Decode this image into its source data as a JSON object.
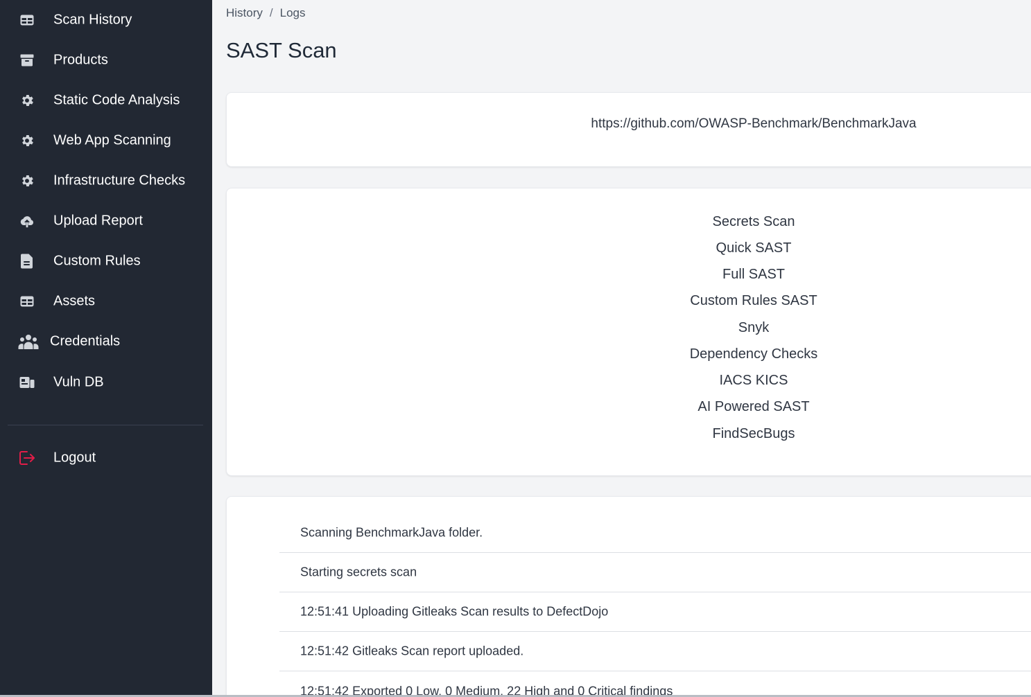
{
  "sidebar": {
    "items": [
      {
        "label": "Scan History",
        "icon": "table-icon"
      },
      {
        "label": "Products",
        "icon": "archive-icon"
      },
      {
        "label": "Static Code Analysis",
        "icon": "gear-icon"
      },
      {
        "label": "Web App Scanning",
        "icon": "gear-icon"
      },
      {
        "label": "Infrastructure Checks",
        "icon": "gear-icon"
      },
      {
        "label": "Upload Report",
        "icon": "cloud-upload-icon"
      },
      {
        "label": "Custom Rules",
        "icon": "document-icon"
      },
      {
        "label": "Assets",
        "icon": "table-icon"
      },
      {
        "label": "Credentials",
        "icon": "people-icon"
      },
      {
        "label": "Vuln DB",
        "icon": "database-icon"
      }
    ],
    "logout": {
      "label": "Logout",
      "icon": "logout-icon",
      "color": "#e11d48"
    }
  },
  "breadcrumb": {
    "items": [
      "History",
      "Logs"
    ],
    "separator": "/"
  },
  "page": {
    "title": "SAST Scan"
  },
  "repo": {
    "url": "https://github.com/OWASP-Benchmark/BenchmarkJava"
  },
  "scan_options": [
    "Secrets Scan",
    "Quick SAST",
    "Full SAST",
    "Custom Rules SAST",
    "Snyk",
    "Dependency Checks",
    "IACS KICS",
    "AI Powered SAST",
    "FindSecBugs"
  ],
  "logs": [
    "Scanning BenchmarkJava folder.",
    "Starting secrets scan",
    "12:51:41 Uploading Gitleaks Scan results to DefectDojo",
    "12:51:42 Gitleaks Scan report uploaded.",
    "12:51:42 Exported 0 Low, 0 Medium, 22 High and 0 Critical findings"
  ],
  "colors": {
    "sidebar_bg": "#222833",
    "main_bg": "#f3f4f6",
    "card_bg": "#ffffff",
    "logout_accent": "#e11d48"
  }
}
